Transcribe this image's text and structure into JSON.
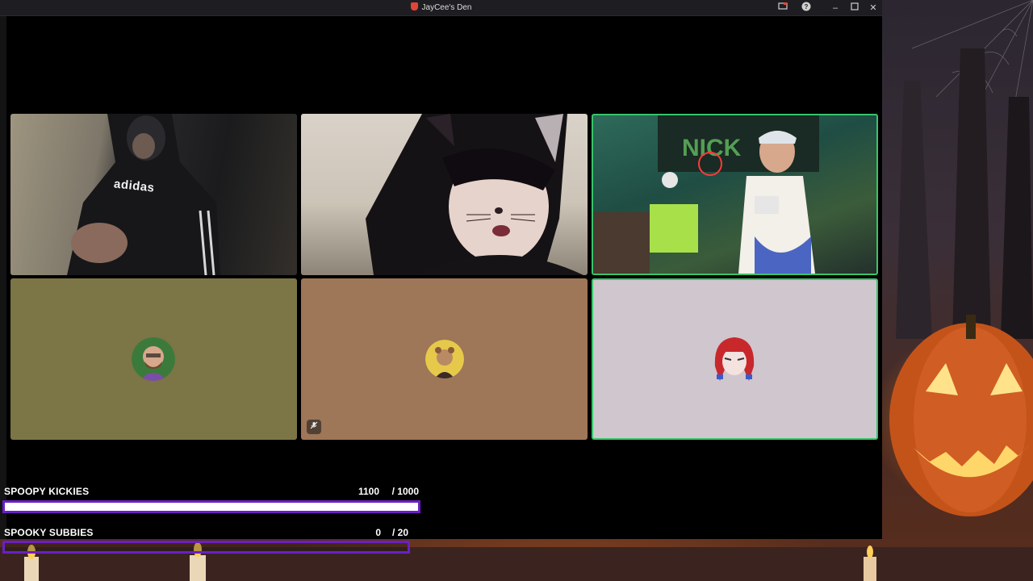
{
  "window": {
    "title": "JayCee's Den",
    "controls": [
      "screen-share-icon",
      "help-icon",
      "minimize-icon",
      "maximize-icon",
      "close-icon"
    ]
  },
  "participants": [
    {
      "kind": "video",
      "shirt_text": "adidas"
    },
    {
      "kind": "video"
    },
    {
      "kind": "video",
      "speaking": true
    },
    {
      "kind": "avatar",
      "tile_color": "#7c7546"
    },
    {
      "kind": "avatar",
      "tile_color": "#9e7658",
      "muted": true
    },
    {
      "kind": "avatar",
      "tile_color": "#cfc6ce",
      "speaking": true
    }
  ],
  "goals": [
    {
      "label": "SPOOPY KICKIES",
      "count": "1100",
      "target": "/ 1000",
      "progress": 1.0
    },
    {
      "label": "SPOOKY SUBBIES",
      "count": "0",
      "target": "/ 20",
      "progress": 0.0
    }
  ],
  "colors": {
    "goal_border": "#6a1fc6",
    "speaking_border": "#39c46a",
    "titlebar": "#1e1e22"
  }
}
